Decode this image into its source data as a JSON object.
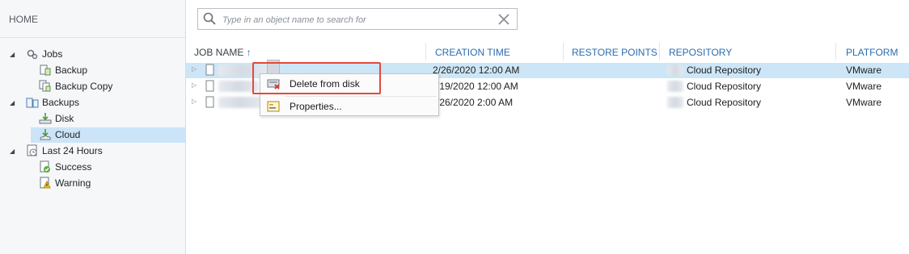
{
  "home": {
    "label": "HOME"
  },
  "tree": {
    "jobs": "Jobs",
    "backup": "Backup",
    "backup_copy": "Backup Copy",
    "backups": "Backups",
    "disk": "Disk",
    "cloud": "Cloud",
    "last24": "Last 24 Hours",
    "success": "Success",
    "warning": "Warning"
  },
  "search": {
    "placeholder": "Type in an object name to search for",
    "value": ""
  },
  "columns": {
    "job_name": "JOB NAME",
    "creation_time": "CREATION TIME",
    "restore_points": "RESTORE POINTS",
    "repository": "REPOSITORY",
    "platform": "PLATFORM"
  },
  "rows": [
    {
      "creation_time": "2/26/2020 12:00 AM",
      "restore_points": "",
      "repository": "Cloud Repository",
      "platform": "VMware"
    },
    {
      "creation_time": "/19/2020 12:00 AM",
      "restore_points": "",
      "repository": "Cloud Repository",
      "platform": "VMware"
    },
    {
      "creation_time": "/26/2020 2:00 AM",
      "restore_points": "",
      "repository": "Cloud Repository",
      "platform": "VMware"
    }
  ],
  "context_menu": {
    "delete_label": "Delete from disk",
    "properties_label": "Properties..."
  },
  "colors": {
    "accent": "#2a6cb0",
    "selection": "#cde6f7",
    "highlight": "#e5483d"
  },
  "icons": {
    "jobs": "jobs-gear-icon",
    "backup": "backup-job-icon",
    "backup_copy": "backup-copy-job-icon",
    "backups": "backups-icon",
    "disk": "disk-icon",
    "cloud": "cloud-icon",
    "last24": "clock-icon",
    "success": "success-icon",
    "warning": "warning-icon",
    "delete": "delete-from-disk-icon",
    "properties": "properties-icon"
  }
}
